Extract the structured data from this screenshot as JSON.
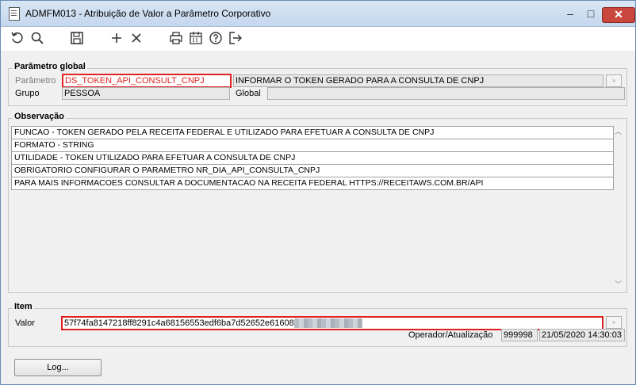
{
  "window": {
    "title": "ADMFM013 - Atribuição de Valor a Parâmetro Corporativo",
    "minimize": "–",
    "maximize": "□",
    "close": "✕"
  },
  "toolbar": {
    "icons": [
      "undo-icon",
      "search-icon",
      "save-icon",
      "add-icon",
      "delete-icon",
      "print-icon",
      "calendar-icon",
      "help-icon",
      "exit-icon"
    ]
  },
  "parametro_global": {
    "title": "Parâmetro global",
    "parametro_label": "Parâmetro",
    "parametro_value": "DS_TOKEN_API_CONSULT_CNPJ",
    "parametro_desc": "INFORMAR O TOKEN GERADO PARA A CONSULTA DE CNPJ",
    "grupo_label": "Grupo",
    "grupo_value": "PESSOA",
    "global_label": "Global",
    "global_value": "",
    "lookup_glyph": "»"
  },
  "observacao": {
    "title": "Observação",
    "lines": [
      "FUNCAO - TOKEN GERADO PELA RECEITA FEDERAL E UTILIZADO PARA EFETUAR A CONSULTA DE CNPJ",
      "FORMATO - STRING",
      "UTILIDADE - TOKEN UTILIZADO PARA EFETUAR A CONSULTA DE CNPJ",
      "OBRIGATORIO CONFIGURAR O PARAMETRO NR_DIA_API_CONSULTA_CNPJ",
      "PARA MAIS INFORMACOES CONSULTAR A DOCUMENTACAO NA RECEITA FEDERAL HTTPS://RECEITAWS.COM.BR/API"
    ]
  },
  "item": {
    "title": "Item",
    "valor_label": "Valor",
    "valor_value": "57f74fa8147218ff8291c4a68156553edf6ba7d52652e61608",
    "lookup_glyph": "»",
    "operador_label": "Operador/Atualização",
    "operador_value": "999998",
    "atualizacao_value": "21/05/2020 14:30:03"
  },
  "log_button": "Log...",
  "colors": {
    "highlight": "#e02020",
    "close": "#c9473c"
  }
}
